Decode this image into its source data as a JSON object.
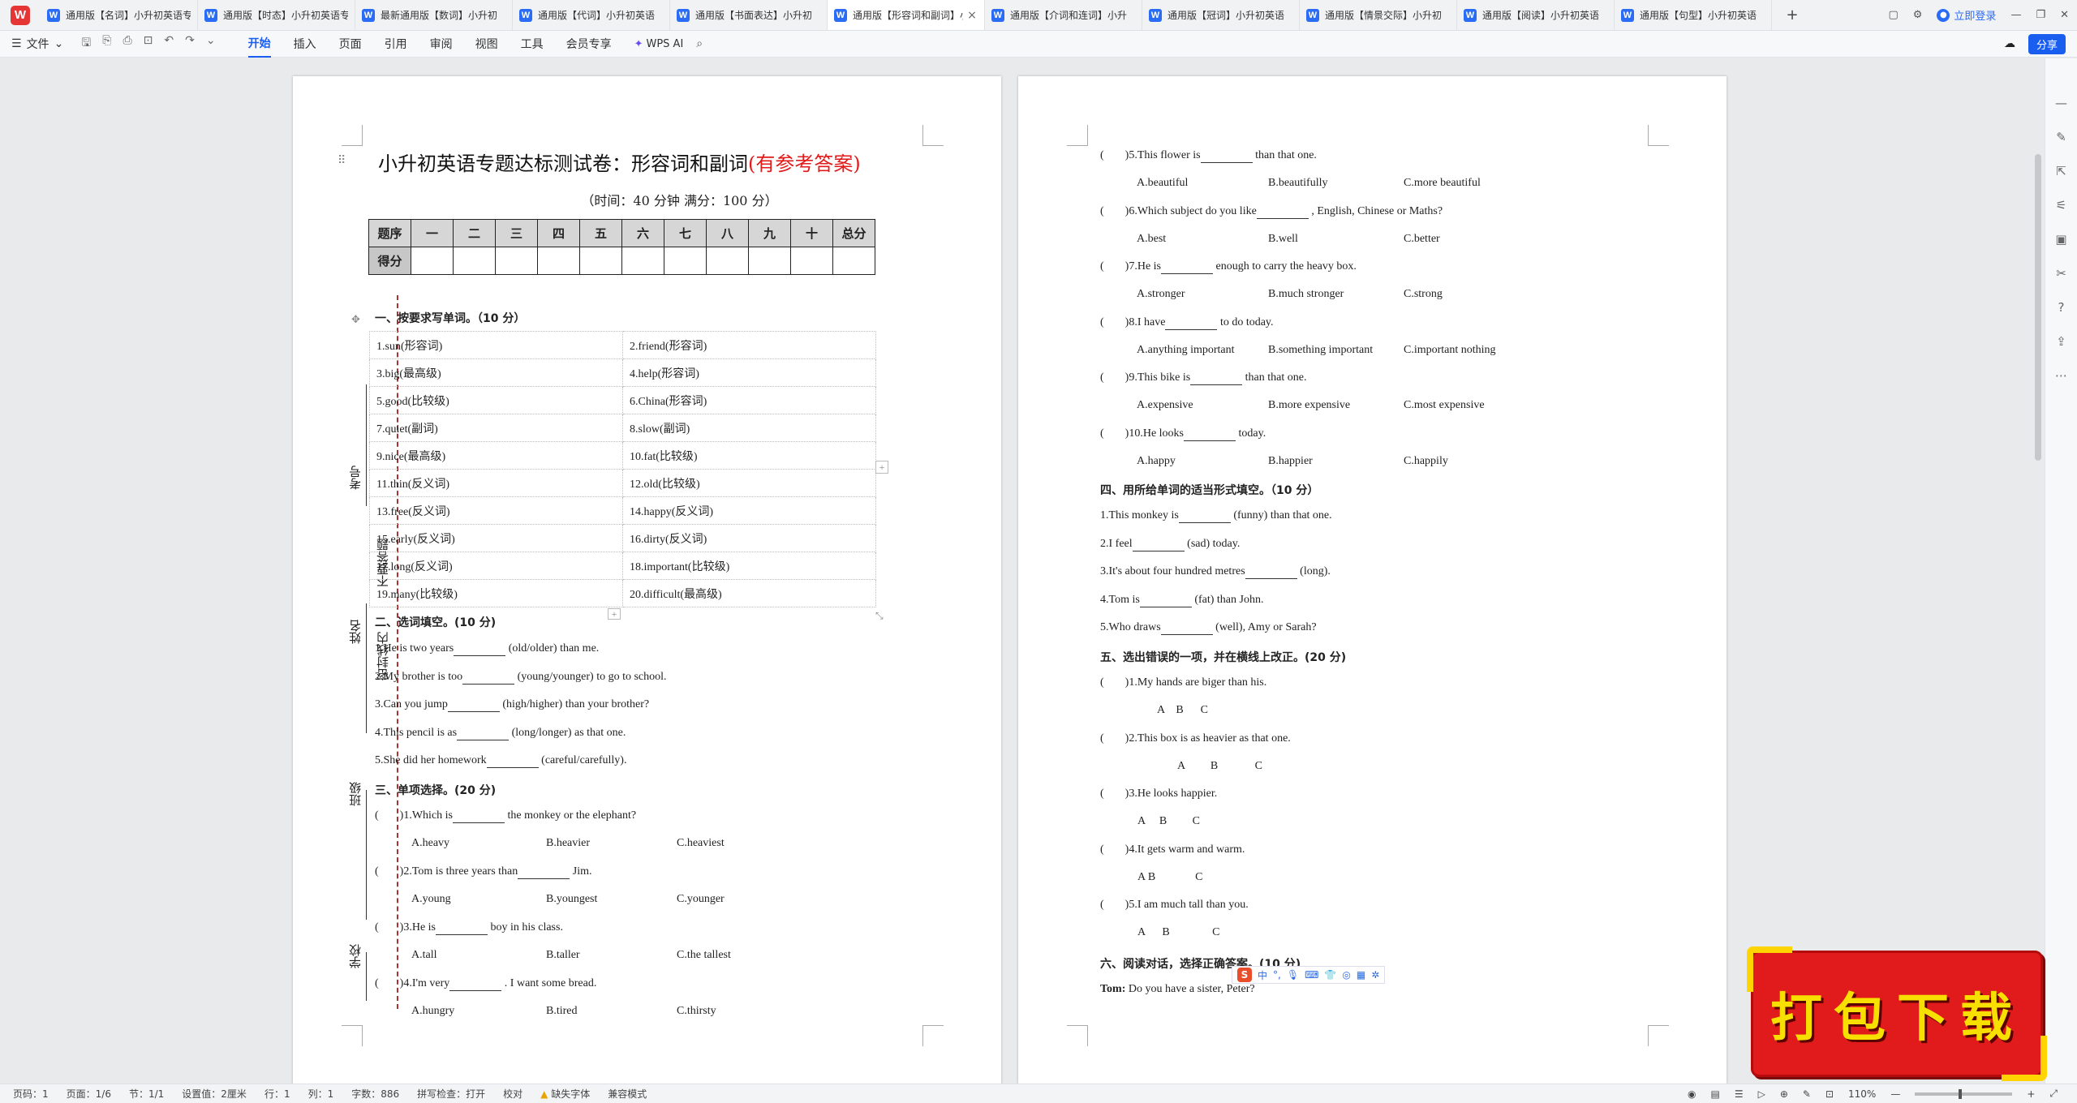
{
  "app": {
    "logo": "W",
    "login": "立即登录",
    "share": "分享"
  },
  "tabs": [
    {
      "label": "通用版【名词】小升初英语专"
    },
    {
      "label": "通用版【时态】小升初英语专"
    },
    {
      "label": "最新通用版【数词】小升初"
    },
    {
      "label": "通用版【代词】小升初英语"
    },
    {
      "label": "通用版【书面表达】小升初"
    },
    {
      "label": "通用版【形容词和副词】小"
    },
    {
      "label": "通用版【介词和连词】小升"
    },
    {
      "label": "通用版【冠词】小升初英语"
    },
    {
      "label": "通用版【情景交际】小升初"
    },
    {
      "label": "通用版【阅读】小升初英语"
    },
    {
      "label": "通用版【句型】小升初英语"
    }
  ],
  "ribbon": {
    "file": "文件",
    "tabs": [
      "开始",
      "插入",
      "页面",
      "引用",
      "审阅",
      "视图",
      "工具",
      "会员专享"
    ],
    "active_tab": "开始",
    "wps_ai": "WPS AI"
  },
  "page1": {
    "title_main": "小升初英语专题达标测试卷：形容词和副词",
    "title_red": "(有参考答案)",
    "subtitle": "（时间：40 分钟        满分：100 分）",
    "score_table": {
      "header": [
        "题序",
        "一",
        "二",
        "三",
        "四",
        "五",
        "六",
        "七",
        "八",
        "九",
        "十",
        "总分"
      ],
      "row2_label": "得分"
    },
    "margin": {
      "school": "学校",
      "class": "班级",
      "name": "姓名",
      "exam_no": "考号",
      "seal": "密封线内",
      "no_answer": "不要答题"
    },
    "sec1": "一、按要求写单词。（10 分）",
    "words": [
      [
        "1.sun(形容词)",
        "2.friend(形容词)"
      ],
      [
        "3.big(最高级)",
        "4.help(形容词)"
      ],
      [
        "5.good(比较级)",
        "6.China(形容词)"
      ],
      [
        "7.quiet(副词)",
        "8.slow(副词)"
      ],
      [
        "9.nice(最高级)",
        "10.fat(比较级)"
      ],
      [
        "11.thin(反义词)",
        "12.old(比较级)"
      ],
      [
        "13.free(反义词)",
        "14.happy(反义词)"
      ],
      [
        "15.early(反义词)",
        "16.dirty(反义词)"
      ],
      [
        "17.long(反义词)",
        "18.important(比较级)"
      ],
      [
        "19.many(比较级)",
        "20.difficult(最高级)"
      ]
    ],
    "sec2": "二、选词填空。(10 分)",
    "sec2_q": [
      [
        "1.He is two years",
        "(old/older) than me."
      ],
      [
        "2.My brother is too",
        "(young/younger) to go to school."
      ],
      [
        "3.Can you jump",
        "(high/higher) than your brother?"
      ],
      [
        "4.This pencil is as",
        "(long/longer) as that one."
      ],
      [
        "5.She did her homework",
        "(careful/carefully)."
      ]
    ],
    "sec3": "三、单项选择。(20 分)",
    "sec3_q": [
      {
        "pre": ")1.Which is",
        "post": "the monkey or the elephant?",
        "opts": [
          "A.heavy",
          "B.heavier",
          "C.heaviest"
        ]
      },
      {
        "pre": ")2.Tom is three years than",
        "post": "Jim.",
        "opts": [
          "A.young",
          "B.youngest",
          "C.younger"
        ]
      },
      {
        "pre": ")3.He is",
        "post": "boy in his class.",
        "opts": [
          "A.tall",
          "B.taller",
          "C.the tallest"
        ]
      },
      {
        "pre": ")4.I'm very",
        "post": ". I want some bread.",
        "opts": [
          "A.hungry",
          "B.tired",
          "C.thirsty"
        ]
      }
    ]
  },
  "page2": {
    "sec3_q": [
      {
        "pre": ")5.This flower is",
        "post": "than that one.",
        "opts": [
          "A.beautiful",
          "B.beautifully",
          "C.more beautiful"
        ]
      },
      {
        "pre": ")6.Which subject do you like",
        "post": ", English, Chinese or Maths?",
        "opts": [
          "A.best",
          "B.well",
          "C.better"
        ]
      },
      {
        "pre": ")7.He is",
        "post": "enough to carry the heavy box.",
        "opts": [
          "A.stronger",
          "B.much stronger",
          "C.strong"
        ]
      },
      {
        "pre": ")8.I have",
        "post": "to do today.",
        "opts": [
          "A.anything important",
          "B.something important",
          "C.important nothing"
        ]
      },
      {
        "pre": ")9.This bike is",
        "post": "than that one.",
        "opts": [
          "A.expensive",
          "B.more expensive",
          "C.most expensive"
        ]
      },
      {
        "pre": ")10.He looks",
        "post": "today.",
        "opts": [
          "A.happy",
          "B.happier",
          "C.happily"
        ]
      }
    ],
    "sec4": "四、用所给单词的适当形式填空。（10 分）",
    "sec4_q": [
      [
        "1.This monkey is",
        "(funny) than that one."
      ],
      [
        "2.I feel",
        "(sad) today."
      ],
      [
        "3.It's about four hundred metres",
        "(long)."
      ],
      [
        "4.Tom is",
        "(fat) than John."
      ],
      [
        "5.Who draws",
        "(well), Amy or Sarah?"
      ]
    ],
    "sec5": "五、选出错误的一项，并在横线上改正。(20 分)",
    "sec5_q": [
      {
        "text": ")1.My hands are biger than his.",
        "abc": "A    B      C"
      },
      {
        "text": ")2.This box is as heavier as that one.",
        "abc": "A         B             C"
      },
      {
        "text": ")3.He looks happier.",
        "abc": "A     B         C"
      },
      {
        "text": ")4.It gets warm and warm.",
        "abc": "A B              C"
      },
      {
        "text": ")5.I am much tall than you.",
        "abc": "A      B               C"
      }
    ],
    "sec6": "六、阅读对话，选择正确答案。(10 分)",
    "dialog1_speaker": "Tom:",
    "dialog1_text": " Do you have a sister, Peter?"
  },
  "paren": "(",
  "status": {
    "page_no": "页码：1",
    "pages": "页面：1/6",
    "section": "节：1/1",
    "setting": "设置值：2厘米",
    "row": "行：1",
    "col": "列：1",
    "words": "字数：886",
    "spell": "拼写检查：打开",
    "proof": "校对",
    "font_missing": "缺失字体",
    "compat": "兼容模式",
    "zoom": "110%"
  },
  "ime": {
    "label": "中"
  },
  "badge": {
    "text": "打包下载"
  }
}
